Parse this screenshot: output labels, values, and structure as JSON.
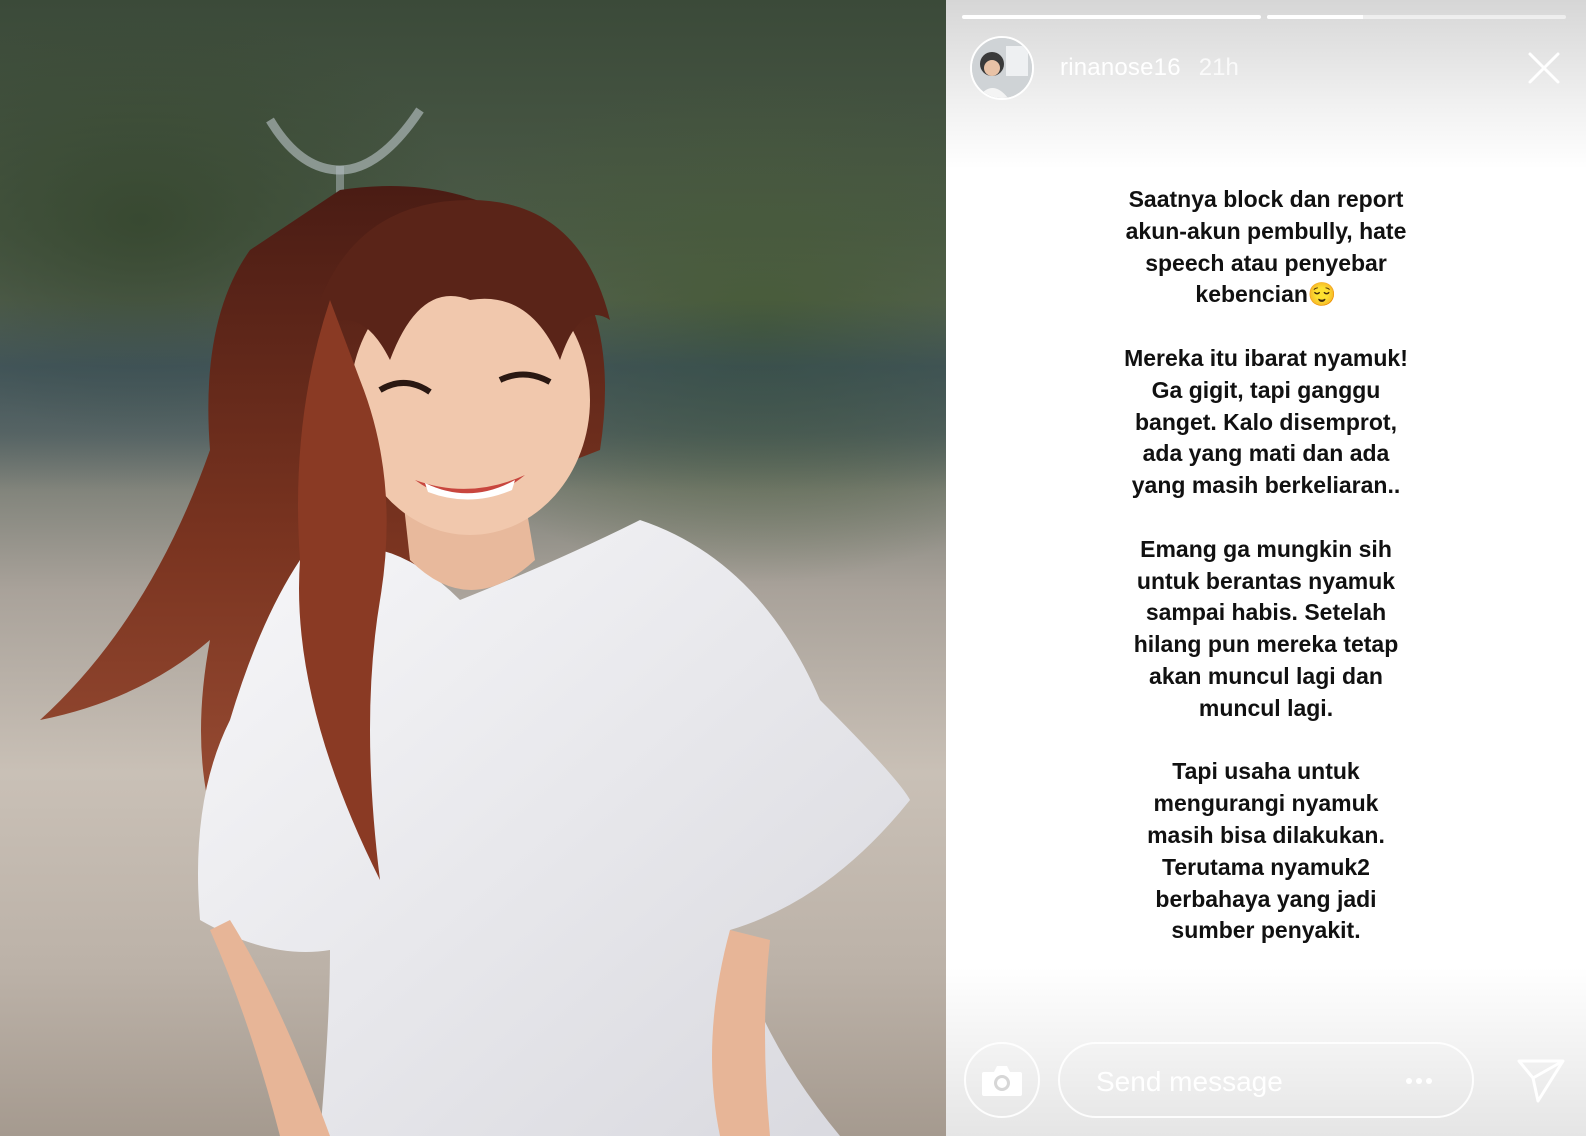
{
  "story": {
    "progress": [
      1.0,
      0.32
    ],
    "username": "rinanose16",
    "time_ago": "21h",
    "text": {
      "p1": "Saatnya block dan report\nakun-akun pembully, hate\nspeech atau penyebar\nkebencian😌",
      "p2": "Mereka itu ibarat nyamuk!\nGa gigit, tapi ganggu\nbanget. Kalo disemprot,\nada yang mati dan ada\nyang masih berkeliaran..",
      "p3": "Emang ga mungkin sih\nuntuk berantas nyamuk\nsampai habis. Setelah\nhilang pun mereka tetap\nakan muncul lagi dan\nmuncul lagi.",
      "p4": "Tapi usaha untuk\nmengurangi nyamuk\nmasih bisa dilakukan.\nTerutama nyamuk2\nberbahaya yang jadi\nsumber penyakit."
    },
    "message_placeholder": "Send message"
  },
  "icons": {
    "close": "close-icon",
    "camera": "camera-icon",
    "more": "more-icon",
    "send": "send-icon"
  },
  "colors": {
    "text": "#111111",
    "panel_bg": "#ffffff",
    "hair": "#6b2a1c",
    "shirt": "#f2f2f4"
  }
}
